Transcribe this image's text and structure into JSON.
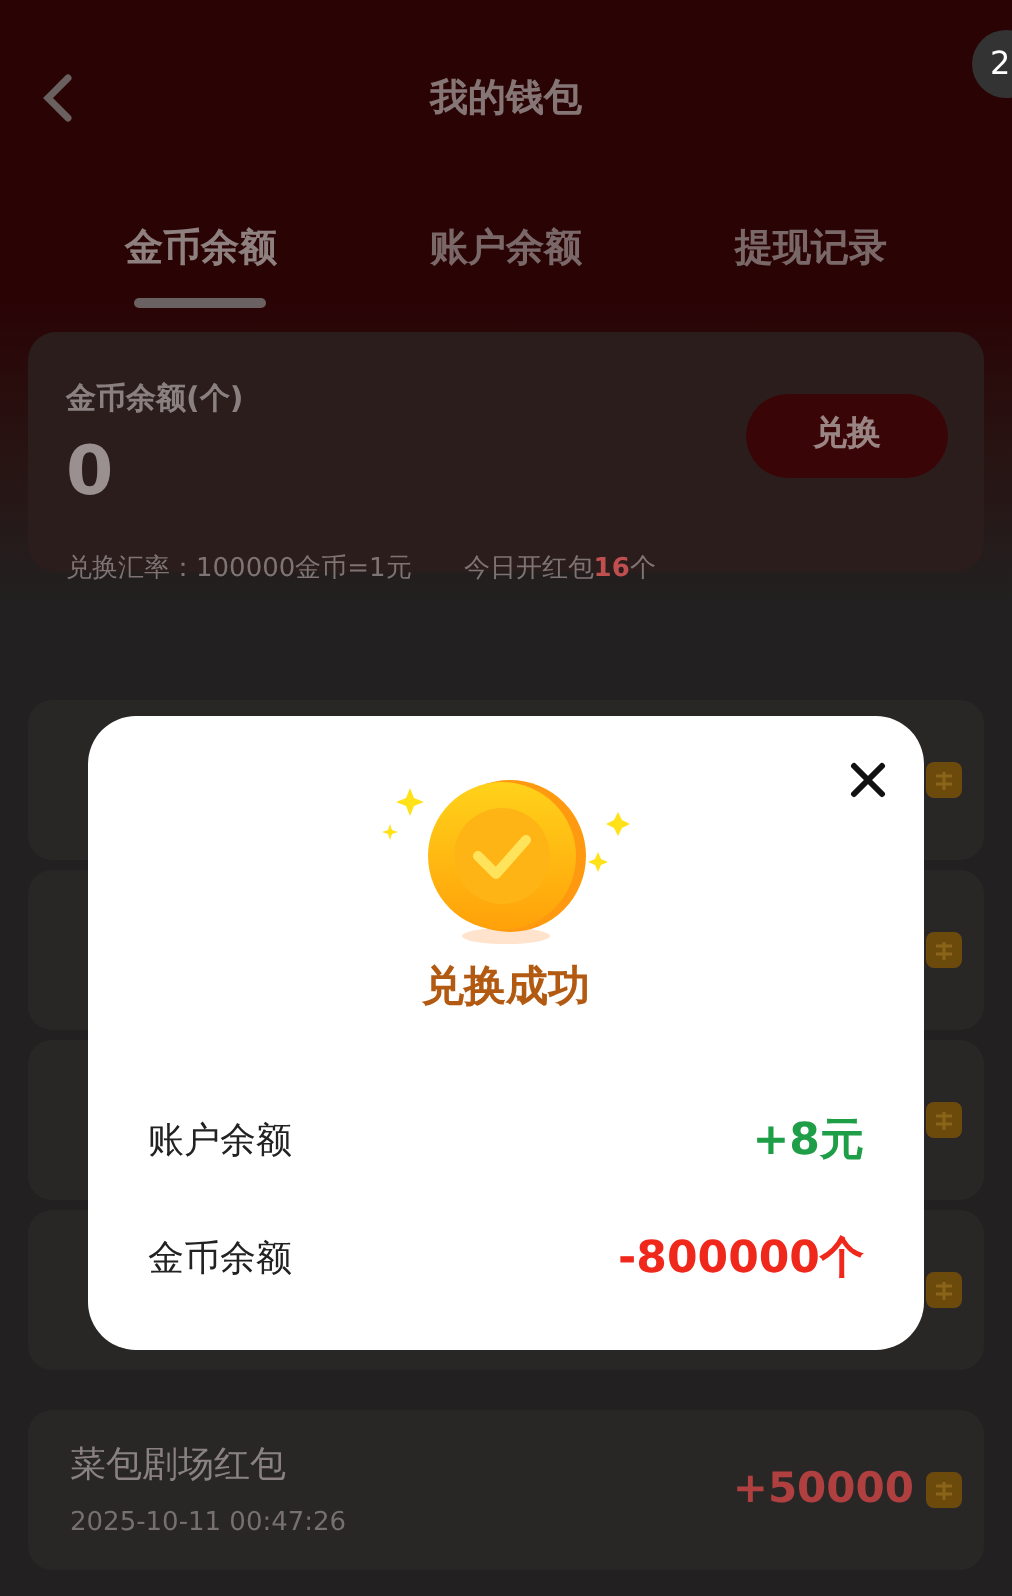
{
  "header": {
    "title": "我的钱包",
    "badge": "2"
  },
  "tabs": [
    {
      "label": "金币余额",
      "selected": true
    },
    {
      "label": "账户余额",
      "selected": false
    },
    {
      "label": "提现记录",
      "selected": false
    }
  ],
  "balance_card": {
    "label": "金币余额(个)",
    "value": "0",
    "button": "兑换",
    "rate": "兑换汇率：100000金币=1元",
    "today_prefix": "今日开红包",
    "today_count": "16",
    "today_suffix": "个"
  },
  "records": [
    {
      "kind": "covered"
    },
    {
      "kind": "covered"
    },
    {
      "kind": "covered"
    },
    {
      "kind": "covered"
    },
    {
      "kind": "entry",
      "title": "菜包剧场红包",
      "time": "2025-10-11 00:47:26",
      "amount": "+50000"
    }
  ],
  "dialog": {
    "title": "兑换成功",
    "rows": [
      {
        "label": "账户余额",
        "value": "+8元",
        "kind": "gain"
      },
      {
        "label": "金币余额",
        "value": "-800000个",
        "kind": "loss"
      }
    ]
  }
}
